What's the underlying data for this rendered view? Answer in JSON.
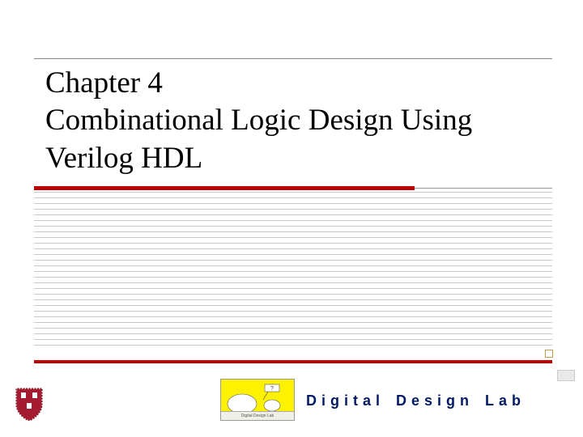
{
  "title": {
    "line1": "Chapter 4",
    "line2": "Combinational Logic Design Using",
    "line3": "Verilog HDL"
  },
  "footer": {
    "lab_text": "Digital Design Lab",
    "logo_caption": "Digital Design Lab"
  },
  "colors": {
    "accent_red": "#c00000",
    "brand_navy": "#001a66",
    "logo_yellow": "#fff200",
    "shield_crimson": "#a51c30"
  }
}
